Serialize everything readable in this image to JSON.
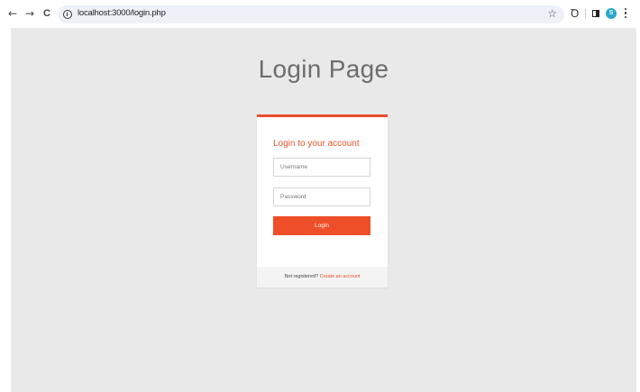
{
  "browser": {
    "url": "localhost:3000/login.php",
    "back_glyph": "←",
    "forward_glyph": "→",
    "reload_glyph": "C",
    "star_glyph": "☆",
    "extensions_glyph": "Ꝺ",
    "avatar_initial": "S",
    "avatar_color": "#2ba7c9"
  },
  "page": {
    "title": "Login Page",
    "card": {
      "heading": "Login to your account",
      "username_placeholder": "Username",
      "password_placeholder": "Password",
      "login_label": "Login",
      "footer_text": "Not registered?",
      "footer_link": "Create an account"
    },
    "colors": {
      "accent": "#ee4e28",
      "background": "#e9e9e9"
    }
  }
}
